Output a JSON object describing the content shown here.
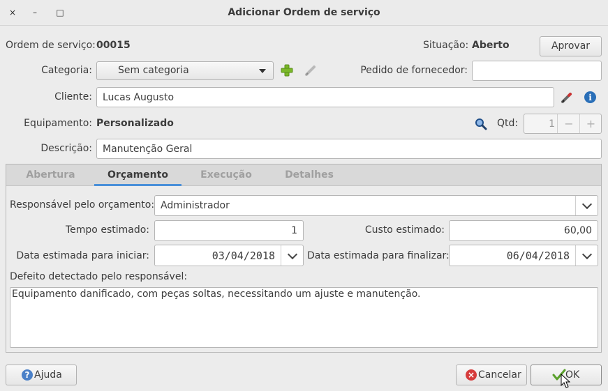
{
  "window": {
    "title": "Adicionar Ordem de serviço",
    "close": "×",
    "minimize": "–",
    "maximize": "□"
  },
  "header": {
    "order_label": "Ordem de serviço:",
    "order_value": "00015",
    "status_label": "Situação:",
    "status_value": "Aberto",
    "approve_button": "Aprovar"
  },
  "form": {
    "category_label": "Categoria:",
    "category_value": "Sem categoria",
    "supplier_order_label": "Pedido de fornecedor:",
    "supplier_order_value": "",
    "client_label": "Cliente:",
    "client_value": "Lucas Augusto",
    "equipment_label": "Equipamento:",
    "equipment_value": "Personalizado",
    "qty_label": "Qtd:",
    "qty_value": "1",
    "qty_minus": "−",
    "qty_plus": "+",
    "description_label": "Descrição:",
    "description_value": "Manutenção Geral"
  },
  "tabs": [
    {
      "label": "Abertura",
      "active": false
    },
    {
      "label": "Orçamento",
      "active": true
    },
    {
      "label": "Execução",
      "active": false
    },
    {
      "label": "Detalhes",
      "active": false
    }
  ],
  "budget": {
    "responsible_label": "Responsável pelo orçamento:",
    "responsible_value": "Administrador",
    "estimated_time_label": "Tempo estimado:",
    "estimated_time_value": "1",
    "estimated_cost_label": "Custo estimado:",
    "estimated_cost_value": "60,00",
    "start_date_label": "Data estimada para iniciar:",
    "start_date_value": "03/04/2018",
    "end_date_label": "Data estimada para finalizar:",
    "end_date_value": "06/04/2018",
    "defect_label": "Defeito detectado pelo responsável:",
    "defect_value": "Equipamento danificado, com peças soltas, necessitando um ajuste e manutenção."
  },
  "footer": {
    "help_button": "Ajuda",
    "cancel_button": "Cancelar",
    "ok_button": "OK"
  },
  "colors": {
    "accent": "#4a90d9",
    "add_green": "#7ab829",
    "info_blue": "#2a6fb8",
    "cancel_red": "#d63c3c",
    "ok_green": "#5aa02c"
  }
}
